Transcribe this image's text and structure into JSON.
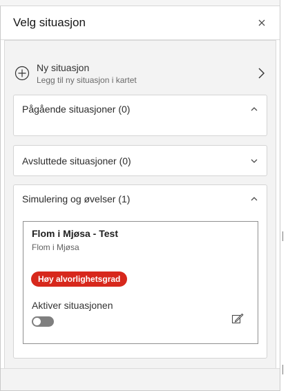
{
  "panel": {
    "title": "Velg situasjon"
  },
  "new_situation": {
    "title": "Ny situasjon",
    "subtitle": "Legg til ny situasjon i kartet"
  },
  "sections": {
    "ongoing": {
      "title": "Pågående situasjoner (0)",
      "state": "expanded"
    },
    "closed": {
      "title": "Avsluttede situasjoner (0)",
      "state": "collapsed"
    },
    "simulation": {
      "title": "Simulering og øvelser (1)",
      "state": "expanded"
    }
  },
  "situation_card": {
    "title": "Flom i Mjøsa - Test",
    "subtitle": "Flom i Mjøsa",
    "severity_badge": "Høy alvorlighetsgrad",
    "activate_label": "Aktiver situasjonen",
    "activate_on": false
  },
  "icons": {
    "close": "close-icon",
    "add": "plus-circle-icon",
    "navigate": "chevron-right-icon",
    "collapse": "chevron-up-icon",
    "expand": "chevron-down-icon",
    "edit": "edit-icon"
  },
  "colors": {
    "severity_high": "#d7281c",
    "toggle_off": "#7f7f7f",
    "panel_background": "#ffffff",
    "body_background": "#f3f3f3"
  }
}
